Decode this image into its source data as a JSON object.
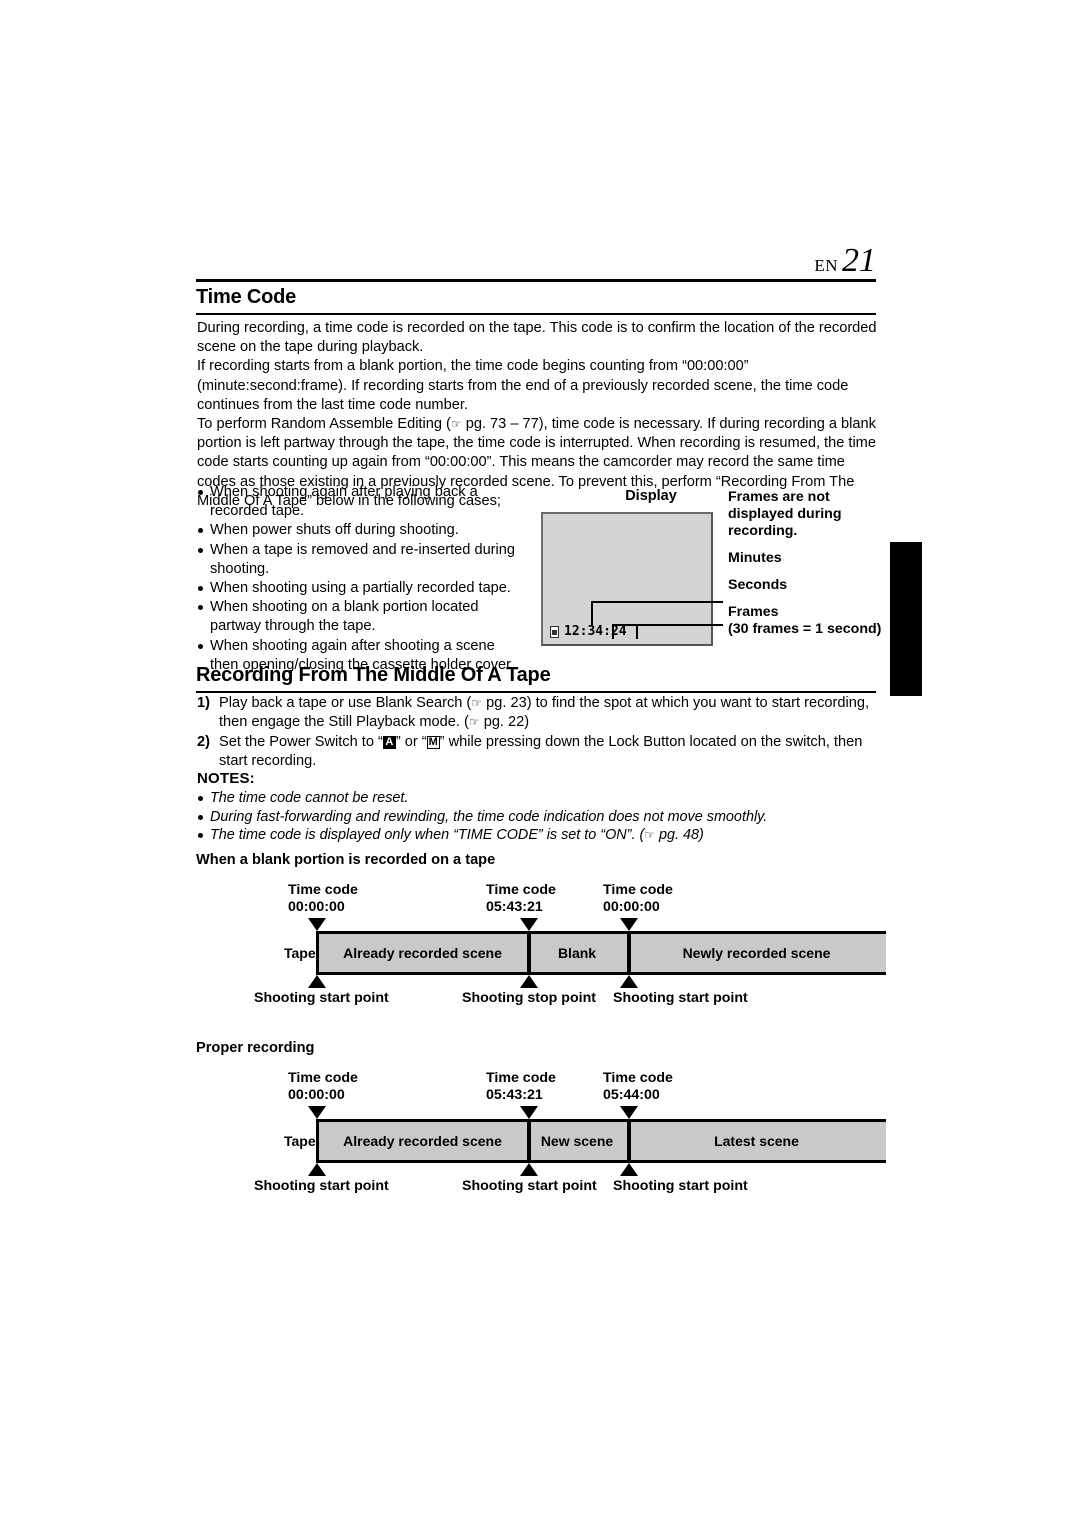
{
  "header": {
    "lang_code": "EN",
    "page_number": "21"
  },
  "sections": {
    "time_code_title": "Time Code",
    "recording_title": "Recording From The Middle Of A Tape"
  },
  "body": {
    "p1": "During recording, a time code is recorded on the tape. This code is to confirm the location of the recorded scene on the tape during playback.",
    "p2": "If recording starts from a blank portion, the time code begins counting from “00:00:00” (minute:second:frame). If recording starts from the end of a previously recorded scene, the time code continues from the last time code number.",
    "p3_a": "To perform Random Assemble Editing (",
    "p3_ref": "pg. 73 – 77",
    "p3_b": "), time code is necessary. If during recording a blank portion is left partway through the tape, the time code is interrupted. When recording is resumed, the time code starts counting up again from “00:00:00”. This means the camcorder may record the same time codes as those existing in a previously recorded scene. To prevent this, perform “Recording From The Middle Of A Tape” below in the following cases;"
  },
  "bullets": [
    "When shooting again after playing back a recorded tape.",
    "When power shuts off during shooting.",
    "When a tape is removed and re-inserted during shooting.",
    "When shooting using a partially recorded tape.",
    "When shooting on a blank portion located partway through the tape.",
    "When shooting again after shooting a scene then opening/closing the cassette holder cover."
  ],
  "display_diagram": {
    "caption": "Display",
    "timecode_value": "12:34:24",
    "tape_icon": "cassette-icon",
    "note": "Frames are not displayed during recording.",
    "labels": {
      "minutes": "Minutes",
      "seconds": "Seconds",
      "frames": "Frames",
      "frames_sub": "(30 frames = 1 second)"
    }
  },
  "steps": [
    {
      "num": "1)",
      "text_a": "Play back a tape or use Blank Search (",
      "ref1": "pg. 23",
      "text_b": ") to find the spot at which you want to start recording, then engage the Still Playback mode. (",
      "ref2": "pg. 22",
      "text_c": ")"
    },
    {
      "num": "2)",
      "text_a": "Set the Power Switch to “",
      "key_a": "A",
      "text_b": "” or “",
      "key_m": "M",
      "text_c": "” while pressing down the Lock Button located on the switch, then start recording."
    }
  ],
  "notes": {
    "title": "NOTES:",
    "items": [
      {
        "text": "The time code cannot be reset.",
        "ref": ""
      },
      {
        "text": "During fast-forwarding and rewinding, the time code indication does not move smoothly.",
        "ref": ""
      },
      {
        "text_a": "The time code is displayed only when “TIME CODE” is set to “ON”. (",
        "ref": "pg. 48",
        "text_b": ")"
      }
    ]
  },
  "diagram1": {
    "title": "When a blank portion is recorded on a tape",
    "tape_word": "Tape",
    "time_codes": [
      {
        "label": "Time code",
        "value": "00:00:00"
      },
      {
        "label": "Time code",
        "value": "05:43:21"
      },
      {
        "label": "Time code",
        "value": "00:00:00"
      }
    ],
    "segments": [
      "Already recorded scene",
      "Blank",
      "Newly recorded scene"
    ],
    "points": [
      "Shooting start point",
      "Shooting stop point",
      "Shooting start point"
    ]
  },
  "diagram2": {
    "title": "Proper recording",
    "tape_word": "Tape",
    "time_codes": [
      {
        "label": "Time code",
        "value": "00:00:00"
      },
      {
        "label": "Time code",
        "value": "05:43:21"
      },
      {
        "label": "Time code",
        "value": "05:44:00"
      }
    ],
    "segments": [
      "Already recorded scene",
      "New scene",
      "Latest scene"
    ],
    "points": [
      "Shooting start point",
      "Shooting start point",
      "Shooting start point"
    ]
  },
  "colors": {
    "tape_fill": "#c9c9c9",
    "display_fill": "#d4d4d4",
    "ink": "#000000"
  }
}
